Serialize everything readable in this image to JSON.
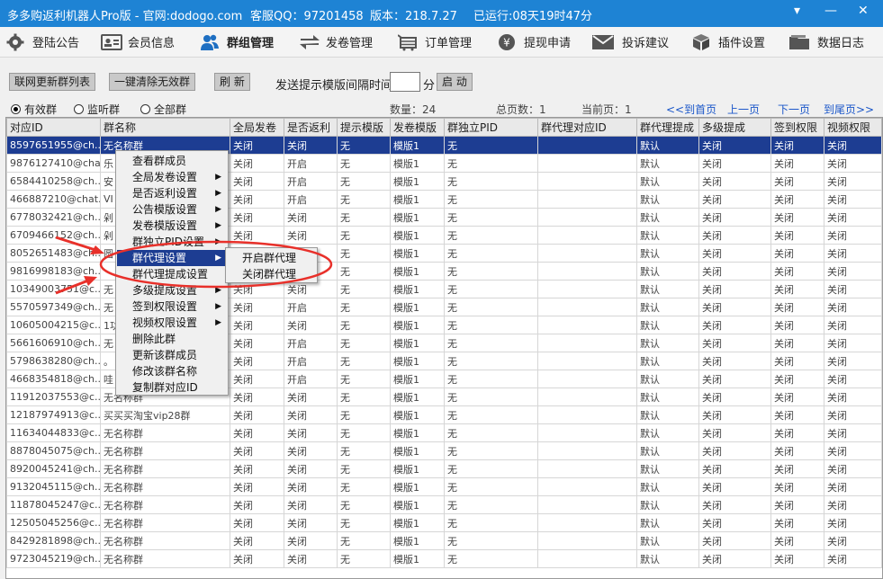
{
  "titlebar": {
    "app": "多多购返利机器人Pro版 - 官网:dodogo.com",
    "qq": "客服QQ：97201458",
    "version": "版本：218.7.27",
    "uptime": "已运行:08天19时47分",
    "min": "▾",
    "minimize": "—",
    "close": "✕"
  },
  "menu": [
    {
      "label": "登陆公告",
      "icon": "gear-icon"
    },
    {
      "label": "会员信息",
      "icon": "id-card-icon"
    },
    {
      "label": "群组管理",
      "icon": "users-icon"
    },
    {
      "label": "发卷管理",
      "icon": "transfer-icon"
    },
    {
      "label": "订单管理",
      "icon": "cart-icon"
    },
    {
      "label": "提现申请",
      "icon": "yen-icon"
    },
    {
      "label": "投诉建议",
      "icon": "mail-icon"
    },
    {
      "label": "插件设置",
      "icon": "cube-icon"
    },
    {
      "label": "数据日志",
      "icon": "folder-icon"
    }
  ],
  "toolbar": {
    "refresh_list": "联网更新群列表",
    "clear_invalid": "一键清除无效群",
    "refresh": "刷 新",
    "interval_label": "发送提示模版间隔时间:",
    "interval_value": "",
    "minute": "分",
    "start": "启 动"
  },
  "filters": {
    "valid": "有效群",
    "monitor": "监听群",
    "all": "全部群",
    "count": "数量：24",
    "pages": "总页数：1",
    "current": "当前页：1",
    "first": "<<到首页",
    "prev": "上一页",
    "next": "下一页",
    "last": "到尾页>>"
  },
  "columns": [
    "对应ID",
    "群名称",
    "全局发卷",
    "是否返利",
    "提示模版",
    "发卷模版",
    "群独立PID",
    "群代理对应ID",
    "群代理提成",
    "多级提成",
    "签到权限",
    "视频权限"
  ],
  "rows": [
    [
      "8597651955@ch...",
      "无名称群",
      "关闭",
      "关闭",
      "无",
      "模版1",
      "无",
      "",
      "默认",
      "关闭",
      "关闭",
      "关闭"
    ],
    [
      "9876127410@chat...",
      "乐",
      "关闭",
      "开启",
      "无",
      "模版1",
      "无",
      "",
      "默认",
      "关闭",
      "关闭",
      "关闭"
    ],
    [
      "6584410258@ch...",
      "安",
      "关闭",
      "开启",
      "无",
      "模版1",
      "无",
      "",
      "默认",
      "关闭",
      "关闭",
      "关闭"
    ],
    [
      "466887210@chat...",
      "VI",
      "关闭",
      "开启",
      "无",
      "模版1",
      "无",
      "",
      "默认",
      "关闭",
      "关闭",
      "关闭"
    ],
    [
      "6778032421@ch...",
      "剁",
      "关闭",
      "关闭",
      "无",
      "模版1",
      "无",
      "",
      "默认",
      "关闭",
      "关闭",
      "关闭"
    ],
    [
      "6709466152@ch...",
      "剁",
      "关闭",
      "关闭",
      "无",
      "模版1",
      "无",
      "",
      "默认",
      "关闭",
      "关闭",
      "关闭"
    ],
    [
      "8052651483@ch...",
      "圆",
      "关闭",
      "关闭",
      "无",
      "模版1",
      "无",
      "",
      "默认",
      "关闭",
      "关闭",
      "关闭"
    ],
    [
      "9816998183@ch...",
      "",
      "关闭",
      "关闭",
      "无",
      "模版1",
      "无",
      "",
      "默认",
      "关闭",
      "关闭",
      "关闭"
    ],
    [
      "10349003751@c...",
      "无",
      "关闭",
      "关闭",
      "无",
      "模版1",
      "无",
      "",
      "默认",
      "关闭",
      "关闭",
      "关闭"
    ],
    [
      "5570597349@ch...",
      "无",
      "关闭",
      "开启",
      "无",
      "模版1",
      "无",
      "",
      "默认",
      "关闭",
      "关闭",
      "关闭"
    ],
    [
      "10605004215@c...",
      "1功",
      "关闭",
      "关闭",
      "无",
      "模版1",
      "无",
      "",
      "默认",
      "关闭",
      "关闭",
      "关闭"
    ],
    [
      "5661606910@ch...",
      "无",
      "关闭",
      "开启",
      "无",
      "模版1",
      "无",
      "",
      "默认",
      "关闭",
      "关闭",
      "关闭"
    ],
    [
      "5798638280@ch...",
      "。",
      "关闭",
      "开启",
      "无",
      "模版1",
      "无",
      "",
      "默认",
      "关闭",
      "关闭",
      "关闭"
    ],
    [
      "4668354818@ch...",
      "哇",
      "关闭",
      "开启",
      "无",
      "模版1",
      "无",
      "",
      "默认",
      "关闭",
      "关闭",
      "关闭"
    ],
    [
      "11912037553@c...",
      "无名称群",
      "关闭",
      "关闭",
      "无",
      "模版1",
      "无",
      "",
      "默认",
      "关闭",
      "关闭",
      "关闭"
    ],
    [
      "12187974913@c...",
      "买买买淘宝vip28群",
      "关闭",
      "关闭",
      "无",
      "模版1",
      "无",
      "",
      "默认",
      "关闭",
      "关闭",
      "关闭"
    ],
    [
      "11634044833@c...",
      "无名称群",
      "关闭",
      "关闭",
      "无",
      "模版1",
      "无",
      "",
      "默认",
      "关闭",
      "关闭",
      "关闭"
    ],
    [
      "8878045075@ch...",
      "无名称群",
      "关闭",
      "关闭",
      "无",
      "模版1",
      "无",
      "",
      "默认",
      "关闭",
      "关闭",
      "关闭"
    ],
    [
      "8920045241@ch...",
      "无名称群",
      "关闭",
      "关闭",
      "无",
      "模版1",
      "无",
      "",
      "默认",
      "关闭",
      "关闭",
      "关闭"
    ],
    [
      "9132045115@ch...",
      "无名称群",
      "关闭",
      "关闭",
      "无",
      "模版1",
      "无",
      "",
      "默认",
      "关闭",
      "关闭",
      "关闭"
    ],
    [
      "11878045247@c...",
      "无名称群",
      "关闭",
      "关闭",
      "无",
      "模版1",
      "无",
      "",
      "默认",
      "关闭",
      "关闭",
      "关闭"
    ],
    [
      "12505045256@c...",
      "无名称群",
      "关闭",
      "关闭",
      "无",
      "模版1",
      "无",
      "",
      "默认",
      "关闭",
      "关闭",
      "关闭"
    ],
    [
      "8429281898@ch...",
      "无名称群",
      "关闭",
      "关闭",
      "无",
      "模版1",
      "无",
      "",
      "默认",
      "关闭",
      "关闭",
      "关闭"
    ],
    [
      "9723045219@ch...",
      "无名称群",
      "关闭",
      "关闭",
      "无",
      "模版1",
      "无",
      "",
      "默认",
      "关闭",
      "关闭",
      "关闭"
    ]
  ],
  "context_menu": [
    {
      "label": "查看群成员",
      "sub": false
    },
    {
      "label": "全局发卷设置",
      "sub": true
    },
    {
      "label": "是否返利设置",
      "sub": true
    },
    {
      "label": "公告模版设置",
      "sub": true
    },
    {
      "label": "发卷模版设置",
      "sub": true
    },
    {
      "label": "群独立PID设置",
      "sub": true
    },
    {
      "label": "群代理设置",
      "sub": true
    },
    {
      "label": "群代理提成设置",
      "sub": false
    },
    {
      "label": "多级提成设置",
      "sub": true
    },
    {
      "label": "签到权限设置",
      "sub": true
    },
    {
      "label": "视频权限设置",
      "sub": true
    },
    {
      "label": "删除此群",
      "sub": false
    },
    {
      "label": "更新该群成员",
      "sub": false
    },
    {
      "label": "修改该群名称",
      "sub": false
    },
    {
      "label": "复制群对应ID",
      "sub": false
    }
  ],
  "submenu": [
    "开启群代理",
    "关闭群代理"
  ],
  "colors": {
    "titlebar": "#1e83d4",
    "selection": "#1d3d92",
    "annotation": "#e8302a",
    "link": "#1a56c9"
  }
}
